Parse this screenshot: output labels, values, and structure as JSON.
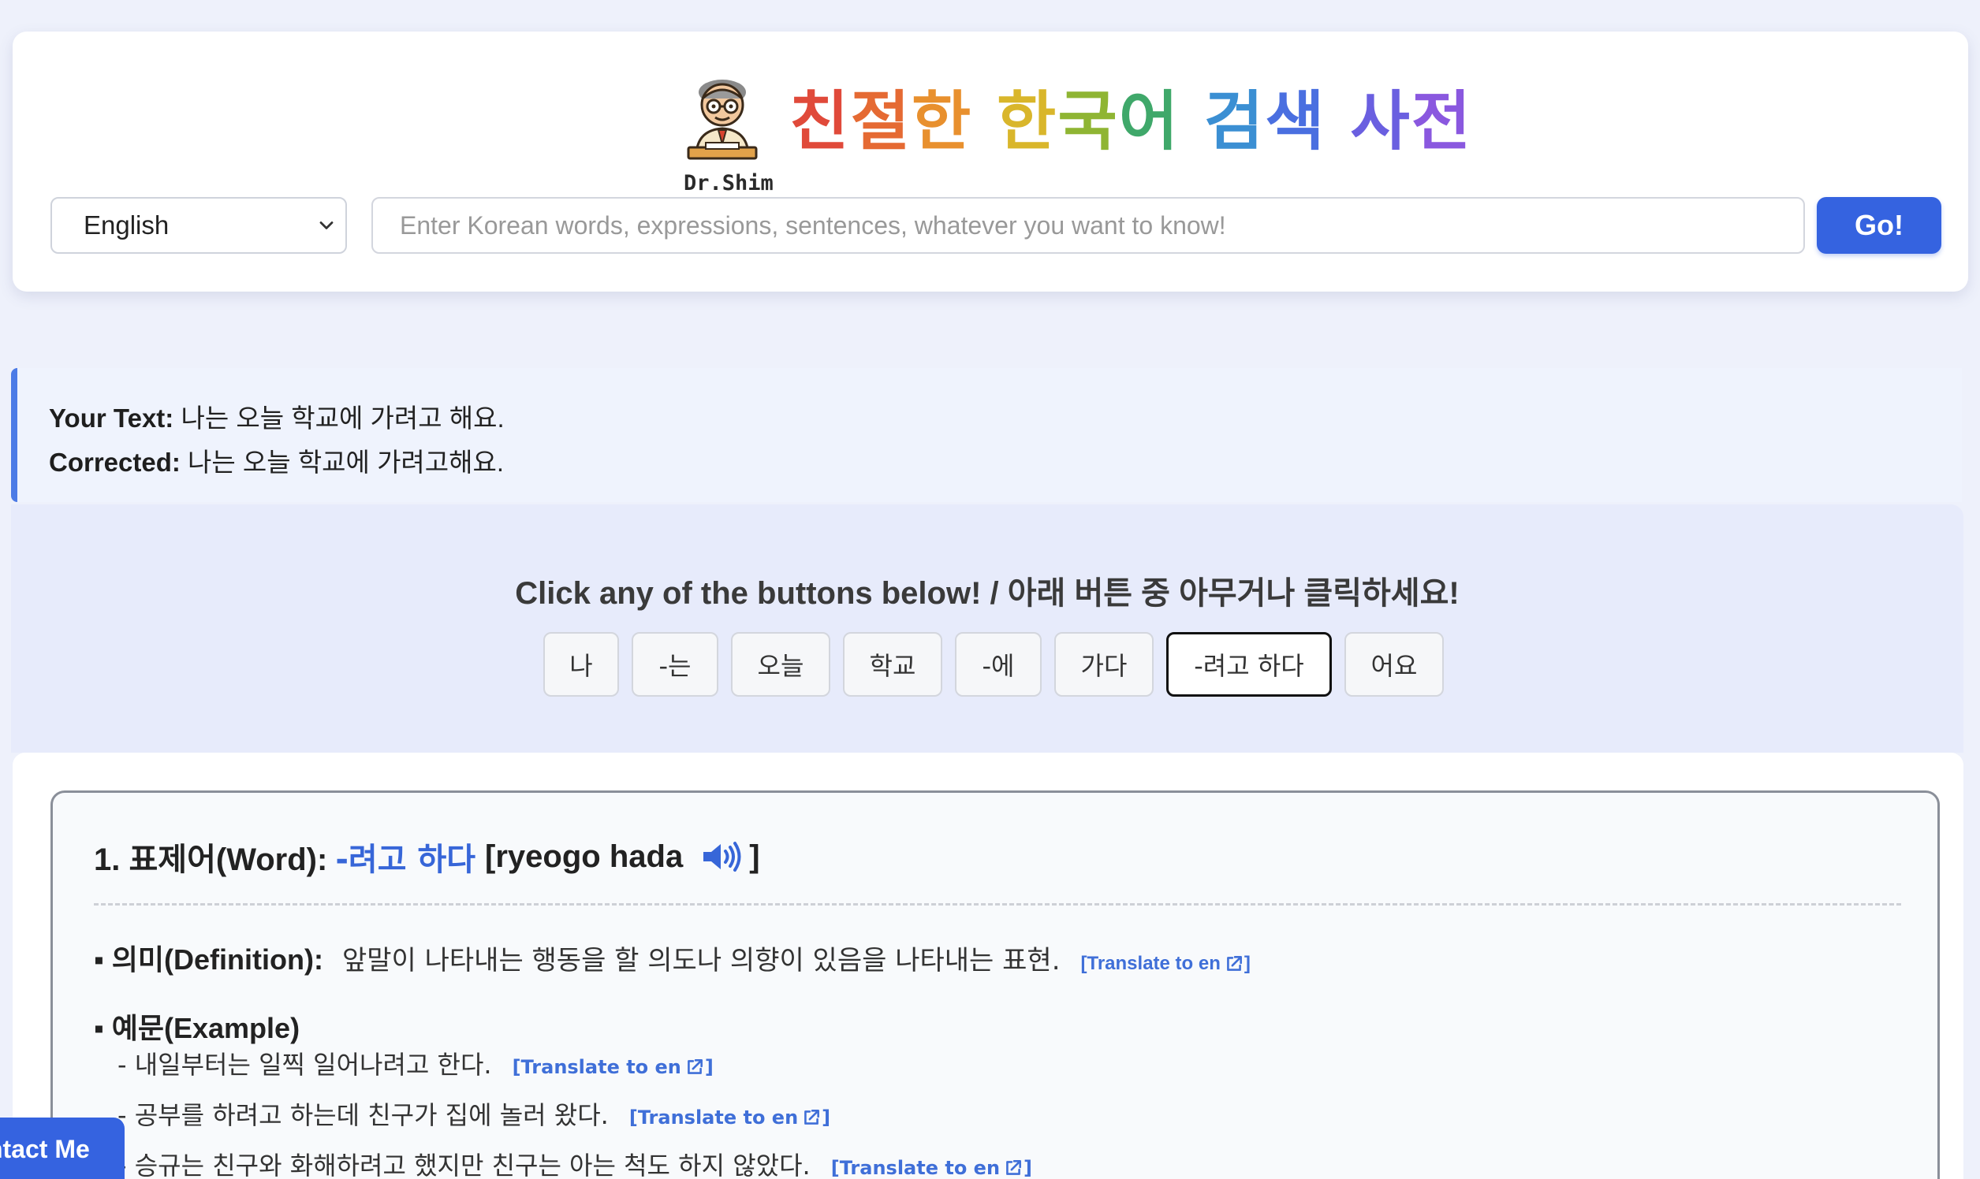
{
  "header": {
    "logo_text": "Dr.Shim",
    "title_chars": [
      "친",
      "절",
      "한",
      " ",
      "한",
      "국",
      "어",
      " ",
      "검",
      "색",
      " ",
      "사",
      "전"
    ],
    "language": "English",
    "search_placeholder": "Enter Korean words, expressions, sentences, whatever you want to know!",
    "go_label": "Go!"
  },
  "correction": {
    "your_text_label": "Your Text:",
    "your_text": "나는 오늘 학교에 가려고 해요.",
    "corrected_label": "Corrected:",
    "corrected": "나는 오늘 학교에 가려고해요."
  },
  "words": {
    "prompt": "Click any of the buttons below! / 아래 버튼 중 아무거나 클릭하세요!",
    "buttons": [
      "나",
      "-는",
      "오늘",
      "학교",
      "-에",
      "가다",
      "-려고 하다",
      "어요"
    ],
    "active_index": 6
  },
  "result": {
    "number_label": "1. 표제어(Word):",
    "headword": "-려고 하다",
    "romanization_open": "[ryeogo hada",
    "romanization_close": "]",
    "definition_label": "▪ 의미(Definition):",
    "definition": "앞말이 나타내는 행동을 할 의도나 의향이 있음을 나타내는 표현.",
    "translate_label": "[Translate to en",
    "example_label": "▪ 예문(Example)",
    "examples": [
      "- 내일부터는 일찍 일어나려고 한다.",
      "- 공부를 하려고 하는데 친구가 집에 놀러 왔다.",
      "- 승규는 친구와 화해하려고 했지만 친구는 아는 척도 하지 않았다."
    ]
  },
  "contact_label": "ntact Me",
  "colors": {
    "accent": "#3563e0",
    "headword": "#3766d8",
    "link": "#3f6fd8"
  }
}
